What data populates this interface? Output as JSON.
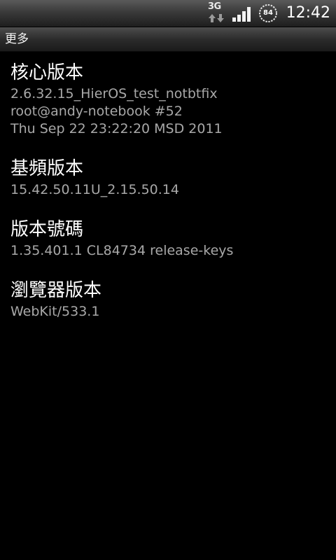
{
  "status_bar": {
    "network_type": "3G",
    "battery_level": "84",
    "time": "12:42"
  },
  "title_bar": {
    "title": "更多"
  },
  "items": [
    {
      "title": "核心版本",
      "lines": [
        "2.6.32.15_HierOS_test_notbtfix",
        "root@andy-notebook #52",
        "Thu Sep 22 23:22:20 MSD 2011"
      ]
    },
    {
      "title": "基頻版本",
      "lines": [
        "15.42.50.11U_2.15.50.14"
      ]
    },
    {
      "title": "版本號碼",
      "lines": [
        "1.35.401.1 CL84734 release-keys"
      ]
    },
    {
      "title": "瀏覽器版本",
      "lines": [
        "WebKit/533.1"
      ]
    }
  ]
}
